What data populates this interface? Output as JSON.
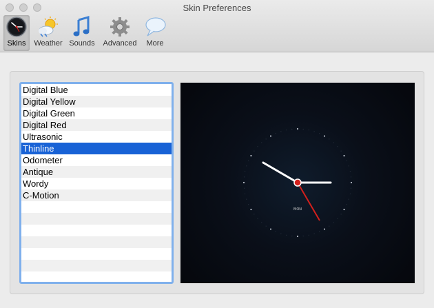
{
  "window": {
    "title": "Skin Preferences"
  },
  "toolbar": {
    "items": [
      {
        "label": "Skins",
        "icon": "clock-icon",
        "selected": true
      },
      {
        "label": "Weather",
        "icon": "weather-sun-cloud-icon",
        "selected": false
      },
      {
        "label": "Sounds",
        "icon": "music-notes-icon",
        "selected": false
      },
      {
        "label": "Advanced",
        "icon": "gear-icon",
        "selected": false
      },
      {
        "label": "More",
        "icon": "speech-bubble-icon",
        "selected": false
      }
    ]
  },
  "skins": {
    "items": [
      "Digital Blue",
      "Digital Yellow",
      "Digital Green",
      "Digital Red",
      "Ultrasonic",
      "Thinline",
      "Odometer",
      "Antique",
      "Wordy",
      "C-Motion"
    ],
    "selected": "Thinline"
  },
  "preview": {
    "day_label": "MON"
  },
  "colors": {
    "selection": "#1862d6",
    "list_focus_ring": "#7fb0ec",
    "second_hand": "#d4201c",
    "preview_background": "#080c14"
  }
}
